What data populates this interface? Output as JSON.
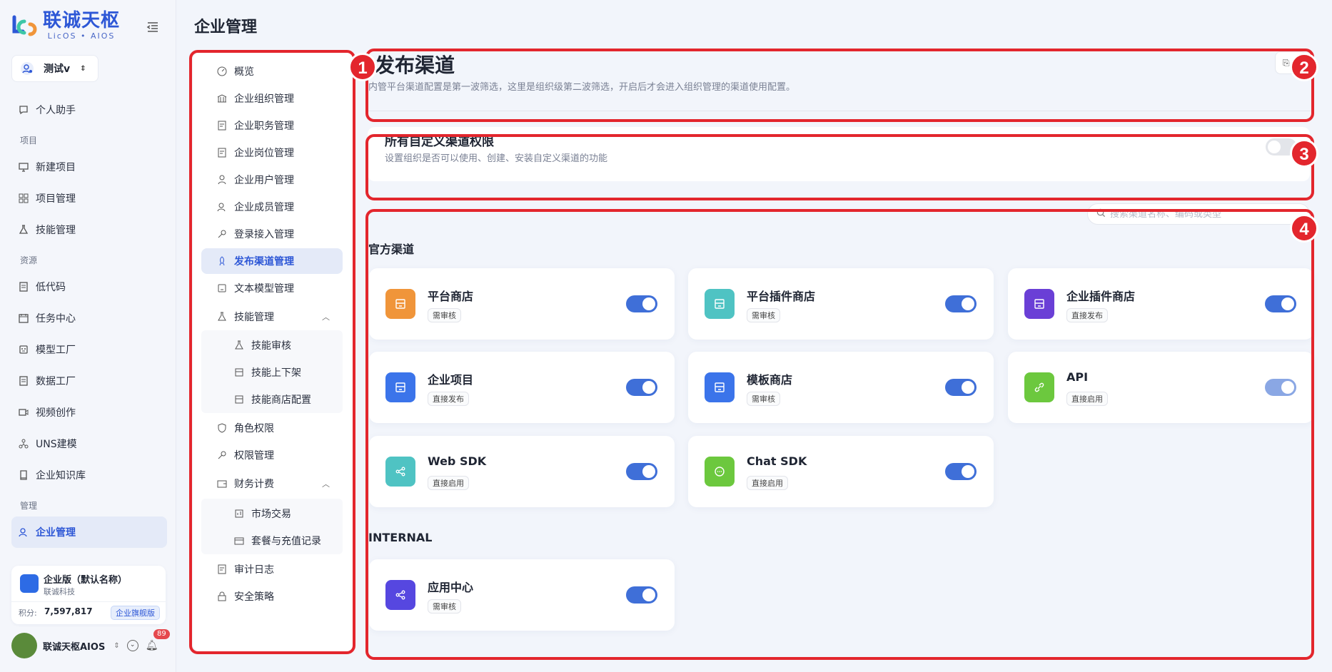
{
  "logo": {
    "cn": "联诚天枢",
    "en": "LicOS • AIOS"
  },
  "workspace": {
    "name": "测试v"
  },
  "nav": {
    "assistant": "个人助手",
    "section_project": "项目",
    "new_project": "新建项目",
    "project_mgmt": "项目管理",
    "skill_mgmt": "技能管理",
    "section_resource": "资源",
    "lowcode": "低代码",
    "task_center": "任务中心",
    "model_factory": "模型工厂",
    "data_factory": "数据工厂",
    "video": "视频创作",
    "uns": "UNS建模",
    "kb": "企业知识库",
    "section_manage": "管理",
    "enterprise": "企业管理"
  },
  "enterprise_card": {
    "name": "企业版（默认名称）",
    "sub": "联诚科技",
    "points_label": "积分:",
    "points": "7,597,817",
    "tier": "企业旗舰版"
  },
  "user": {
    "name": "联诚天枢AIOS",
    "notifications": "89"
  },
  "page_title": "企业管理",
  "sub_nav": {
    "overview": "概览",
    "org": "企业组织管理",
    "duty": "企业职务管理",
    "post": "企业岗位管理",
    "user": "企业用户管理",
    "member": "企业成员管理",
    "login": "登录接入管理",
    "channel": "发布渠道管理",
    "text_model": "文本模型管理",
    "skill": "技能管理",
    "skill_review": "技能审核",
    "skill_shelf": "技能上下架",
    "skill_store": "技能商店配置",
    "role": "角色权限",
    "perm": "权限管理",
    "finance": "财务计费",
    "market": "市场交易",
    "package": "套餐与充值记录",
    "audit": "审计日志",
    "security": "安全策略"
  },
  "header": {
    "title": "发布渠道",
    "desc": "内管平台渠道配置是第一波筛选，这里是组织级第二波筛选，开启后才会进入组织管理的渠道使用配置。"
  },
  "permission": {
    "title": "所有自定义渠道权限",
    "desc": "设置组织是否可以使用、创建、安装自定义渠道的功能",
    "enabled": false
  },
  "search": {
    "placeholder": "搜索渠道名称、编码或类型"
  },
  "groups": {
    "official": "官方渠道",
    "internal": "INTERNAL"
  },
  "channels": [
    {
      "name": "平台商店",
      "tag": "需审核",
      "color": "#f0953a",
      "enabled": true
    },
    {
      "name": "平台插件商店",
      "tag": "需审核",
      "color": "#4fc3c3",
      "enabled": true
    },
    {
      "name": "企业插件商店",
      "tag": "直接发布",
      "color": "#6a3fd6",
      "enabled": true
    },
    {
      "name": "企业项目",
      "tag": "直接发布",
      "color": "#3b74ea",
      "enabled": true
    },
    {
      "name": "模板商店",
      "tag": "需审核",
      "color": "#3b74ea",
      "enabled": true
    },
    {
      "name": "API",
      "tag": "直接启用",
      "color": "#6cc83e",
      "enabled": true
    },
    {
      "name": "Web SDK",
      "tag": "直接启用",
      "color": "#4fc3c3",
      "enabled": true
    },
    {
      "name": "Chat SDK",
      "tag": "直接启用",
      "color": "#6cc83e",
      "enabled": true
    },
    {
      "name": "应用中心",
      "tag": "需审核",
      "color": "#5647e0",
      "enabled": true
    }
  ],
  "annotations": [
    "1",
    "2",
    "3",
    "4"
  ],
  "colors": {
    "accent": "#2d57d6",
    "annotation": "#e3262d"
  }
}
